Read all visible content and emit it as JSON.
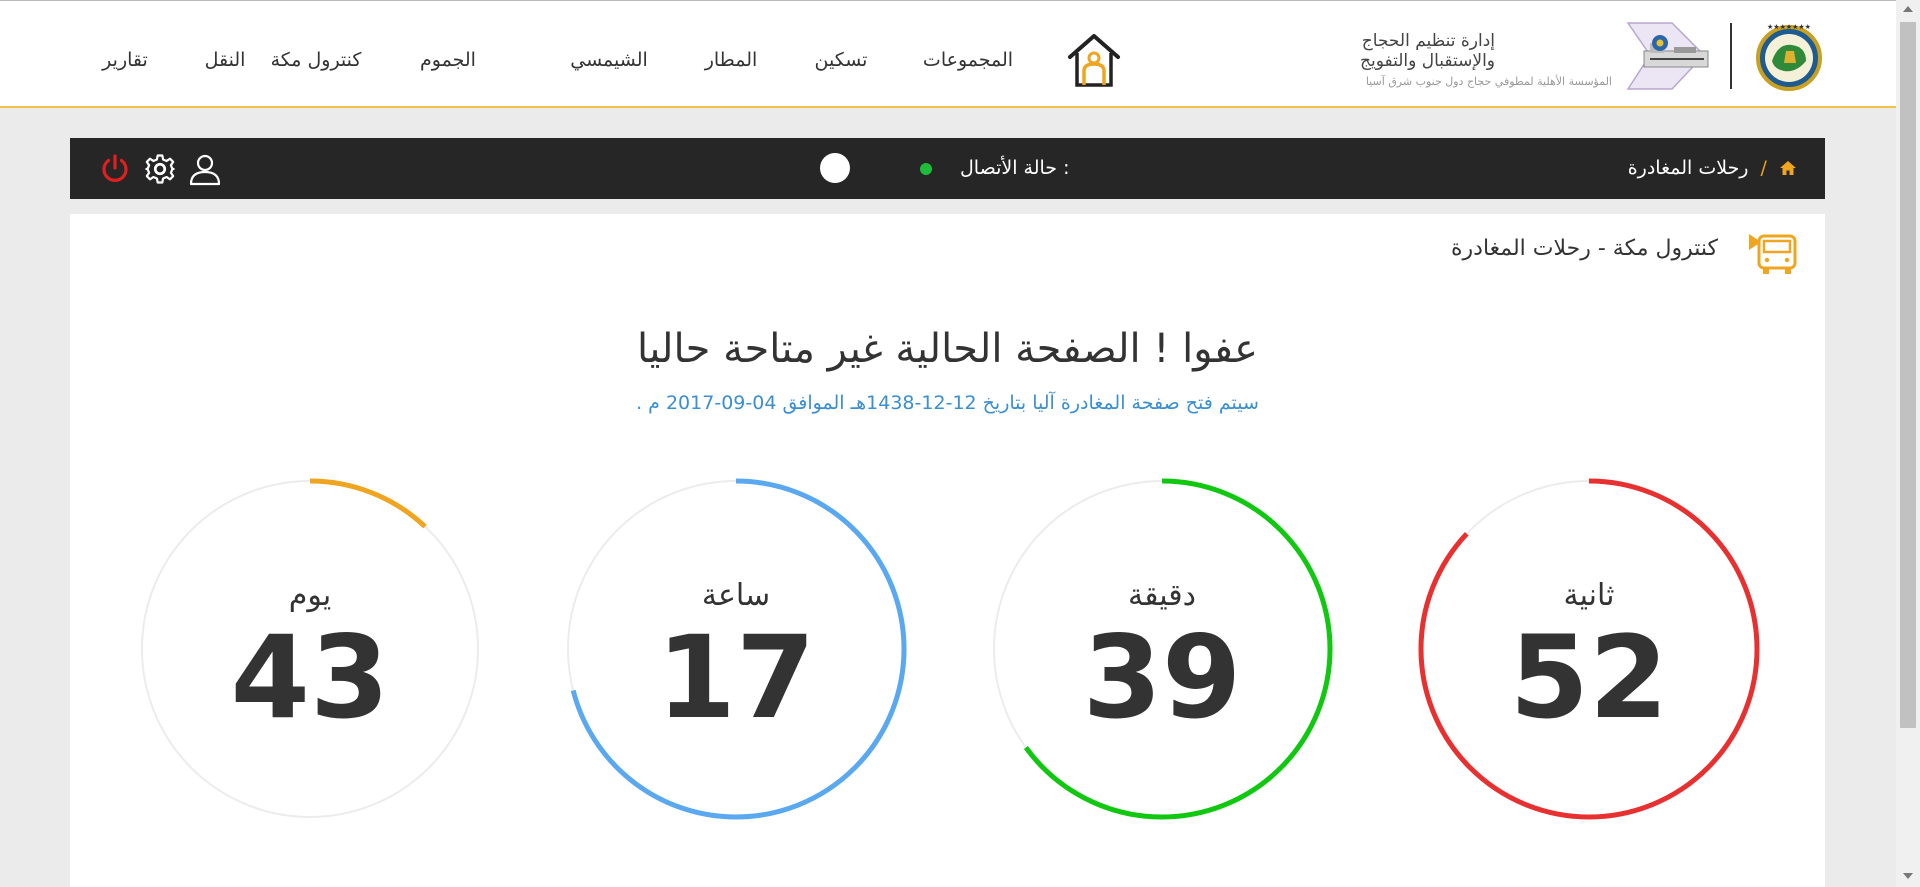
{
  "nav": {
    "items": [
      {
        "label": "تقارير"
      },
      {
        "label": "النقل"
      },
      {
        "label": "كنترول مكة"
      },
      {
        "label": "الجموم"
      },
      {
        "label": "الشيمسي"
      },
      {
        "label": "المطار"
      },
      {
        "label": "تسكين"
      },
      {
        "label": "المجموعات"
      }
    ]
  },
  "brand": {
    "title_line1": "إدارة تنظيم الحجاج",
    "title_line2": "والإستقبال والتفويج",
    "subtitle": "المؤسسة الأهلية لمطوفي حجاج دول جنوب شرق آسيا"
  },
  "toolbar": {
    "breadcrumb_separator": "/",
    "breadcrumb_current": "رحلات المغادرة",
    "connection_label": "حالة الأتصال :",
    "connection_color": "#1dbd3b"
  },
  "page": {
    "heading": "كنترول مكة - رحلات المغادرة",
    "message": "عفوا ! الصفحة الحالية غير متاحة حاليا",
    "submessage": "سيتم فتح صفحة المغادرة آليا بتاريخ 12-12-1438هـ الموافق 04-09-2017 م ."
  },
  "countdown": [
    {
      "label": "يوم",
      "value": "43",
      "color": "#f0a520",
      "progress": 0.12
    },
    {
      "label": "ساعة",
      "value": "17",
      "color": "#5aa8f0",
      "progress": 0.71
    },
    {
      "label": "دقيقة",
      "value": "39",
      "color": "#10c810",
      "progress": 0.65
    },
    {
      "label": "ثانية",
      "value": "52",
      "color": "#e83030",
      "progress": 0.87
    }
  ],
  "colors": {
    "accent": "#f0a520",
    "dark_bar": "#262626",
    "logout": "#e02020"
  }
}
